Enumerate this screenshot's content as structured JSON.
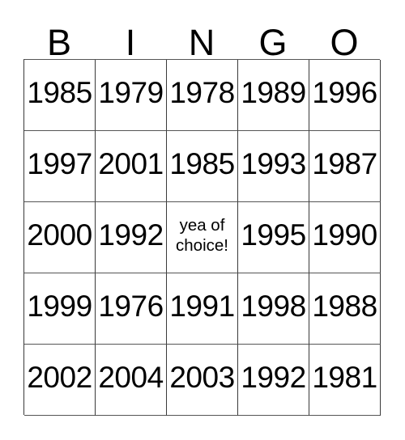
{
  "card": {
    "headers": [
      "B",
      "I",
      "N",
      "G",
      "O"
    ],
    "rows": [
      [
        "1985",
        "1979",
        "1978",
        "1989",
        "1996"
      ],
      [
        "1997",
        "2001",
        "1985",
        "1993",
        "1987"
      ],
      [
        "2000",
        "1992",
        "",
        "1995",
        "1990"
      ],
      [
        "1999",
        "1976",
        "1991",
        "1998",
        "1988"
      ],
      [
        "2002",
        "2004",
        "2003",
        "1992",
        "1981"
      ]
    ],
    "free_space": {
      "line1": "yea of",
      "line2": "choice!"
    },
    "colors": {
      "background": "#ffffff",
      "text": "#000000",
      "grid_line": "#3a3a3a"
    }
  }
}
